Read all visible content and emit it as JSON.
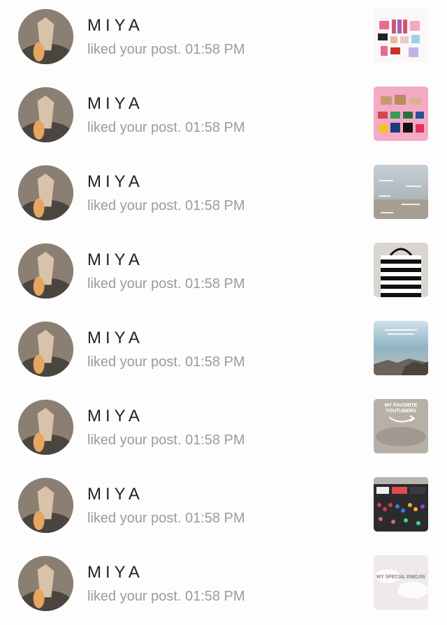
{
  "notifications": [
    {
      "user": "MIYA",
      "action": "liked your post.",
      "time": "01:58 PM",
      "thumb": "gift-collage-thumbnail"
    },
    {
      "user": "MIYA",
      "action": "liked your post.",
      "time": "01:58 PM",
      "thumb": "gift-cards-thumbnail"
    },
    {
      "user": "MIYA",
      "action": "liked your post.",
      "time": "01:58 PM",
      "thumb": "beach-text-thumbnail"
    },
    {
      "user": "MIYA",
      "action": "liked your post.",
      "time": "01:58 PM",
      "thumb": "striped-bag-thumbnail"
    },
    {
      "user": "MIYA",
      "action": "liked your post.",
      "time": "01:58 PM",
      "thumb": "ocean-rocks-thumbnail"
    },
    {
      "user": "MIYA",
      "action": "liked your post.",
      "time": "01:58 PM",
      "thumb": "favorite-youtubers-thumbnail",
      "thumb_text": "MY FAVORITE YOUTUBERS"
    },
    {
      "user": "MIYA",
      "action": "liked your post.",
      "time": "01:58 PM",
      "thumb": "store-shelf-thumbnail"
    },
    {
      "user": "MIYA",
      "action": "liked your post.",
      "time": "01:58 PM",
      "thumb": "clouds-thumbnail",
      "thumb_text": "MY SPECIAL EMOJIS"
    }
  ],
  "icons": {
    "avatar": "user-avatar-photo"
  }
}
